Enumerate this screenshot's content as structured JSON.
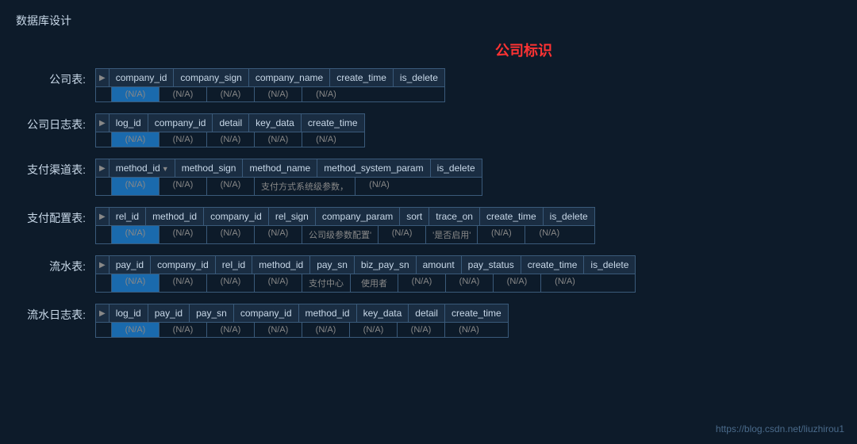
{
  "page": {
    "title": "数据库设计",
    "company_label": "公司标识",
    "watermark": "https://blog.csdn.net/liuzhirou1"
  },
  "sections": [
    {
      "label": "公司表:",
      "columns": [
        "company_id",
        "company_sign",
        "company_name",
        "create_time",
        "is_delete"
      ],
      "cells": [
        "(N/A)",
        "(N/A)",
        "(N/A)",
        "(N/A)",
        "(N/A)"
      ],
      "highlight_col": 0,
      "special_cells": []
    },
    {
      "label": "公司日志表:",
      "columns": [
        "log_id",
        "company_id",
        "detail",
        "key_data",
        "create_time"
      ],
      "cells": [
        "(N/A)",
        "(N/A)",
        "(N/A)",
        "(N/A)",
        "(N/A)"
      ],
      "highlight_col": 0,
      "special_cells": []
    },
    {
      "label": "支付渠道表:",
      "columns": [
        "method_id",
        "method_sign",
        "method_name",
        "method_system_param",
        "is_delete"
      ],
      "cells": [
        "(N/A)",
        "(N/A)",
        "(N/A)",
        "支付方式系统级参数，",
        "(N/A)"
      ],
      "highlight_col": 0,
      "special_cells": [
        3
      ],
      "has_sort": 0
    },
    {
      "label": "支付配置表:",
      "columns": [
        "rel_id",
        "method_id",
        "company_id",
        "rel_sign",
        "company_param",
        "sort",
        "trace_on",
        "create_time",
        "is_delete"
      ],
      "cells": [
        "(N/A)",
        "(N/A)",
        "(N/A)",
        "(N/A)",
        "公司级参数配置'",
        "(N/A)",
        "'是否启用'",
        "(N/A)",
        "(N/A)"
      ],
      "highlight_col": 0,
      "special_cells": [
        4,
        6
      ]
    },
    {
      "label": "流水表:",
      "columns": [
        "pay_id",
        "company_id",
        "rel_id",
        "method_id",
        "pay_sn",
        "biz_pay_sn",
        "amount",
        "pay_status",
        "create_time",
        "is_delete"
      ],
      "cells": [
        "(N/A)",
        "(N/A)",
        "(N/A)",
        "(N/A)",
        "支付中心",
        "使用者",
        "(N/A)",
        "(N/A)",
        "(N/A)",
        "(N/A)"
      ],
      "highlight_col": 0,
      "special_cells": [
        4,
        5
      ]
    },
    {
      "label": "流水日志表:",
      "columns": [
        "log_id",
        "pay_id",
        "pay_sn",
        "company_id",
        "method_id",
        "key_data",
        "detail",
        "create_time"
      ],
      "cells": [
        "(N/A)",
        "(N/A)",
        "(N/A)",
        "(N/A)",
        "(N/A)",
        "(N/A)",
        "(N/A)",
        "(N/A)"
      ],
      "highlight_col": 0,
      "special_cells": []
    }
  ]
}
